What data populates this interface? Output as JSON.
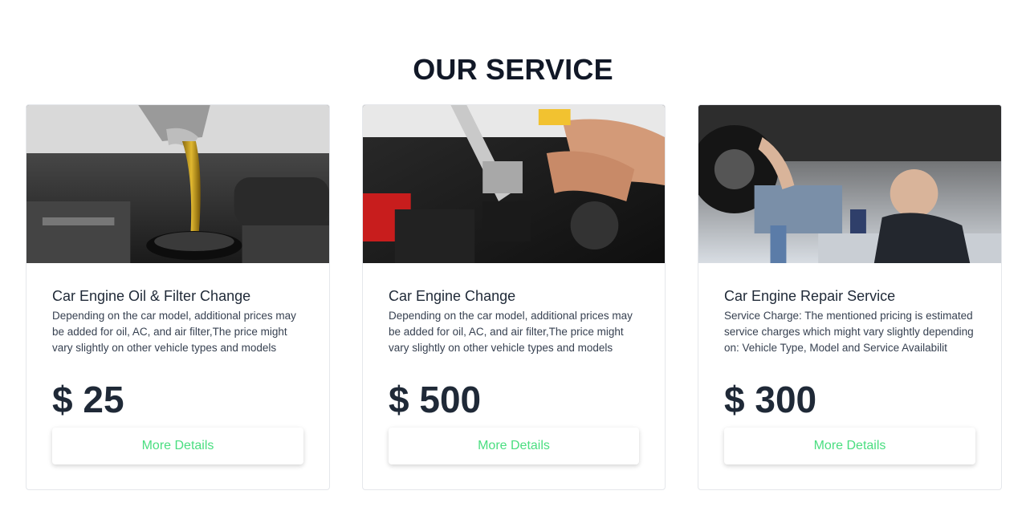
{
  "section": {
    "title": "OUR SERVICE"
  },
  "cards": [
    {
      "image": "oil-pouring-into-engine",
      "title": "Car Engine Oil & Filter Change",
      "description": "Depending on the car model, additional prices may be added for oil, AC, and air filter,The price might vary slightly on other vehicle types and models",
      "price": "$ 25",
      "button": "More Details"
    },
    {
      "image": "wrench-on-engine",
      "title": "Car Engine Change",
      "description": "Depending on the car model, additional prices may be added for oil, AC, and air filter,The price might vary slightly on other vehicle types and models",
      "price": "$ 500",
      "button": "More Details"
    },
    {
      "image": "mechanic-under-car",
      "title": "Car Engine Repair Service",
      "description": "Service Charge: The mentioned pricing is estimated service charges which might vary slightly depending on: Vehicle Type, Model and Service Availabilit",
      "price": "$ 300",
      "button": "More Details"
    }
  ],
  "colors": {
    "button_text": "#4ade80",
    "title_text": "#111827"
  }
}
